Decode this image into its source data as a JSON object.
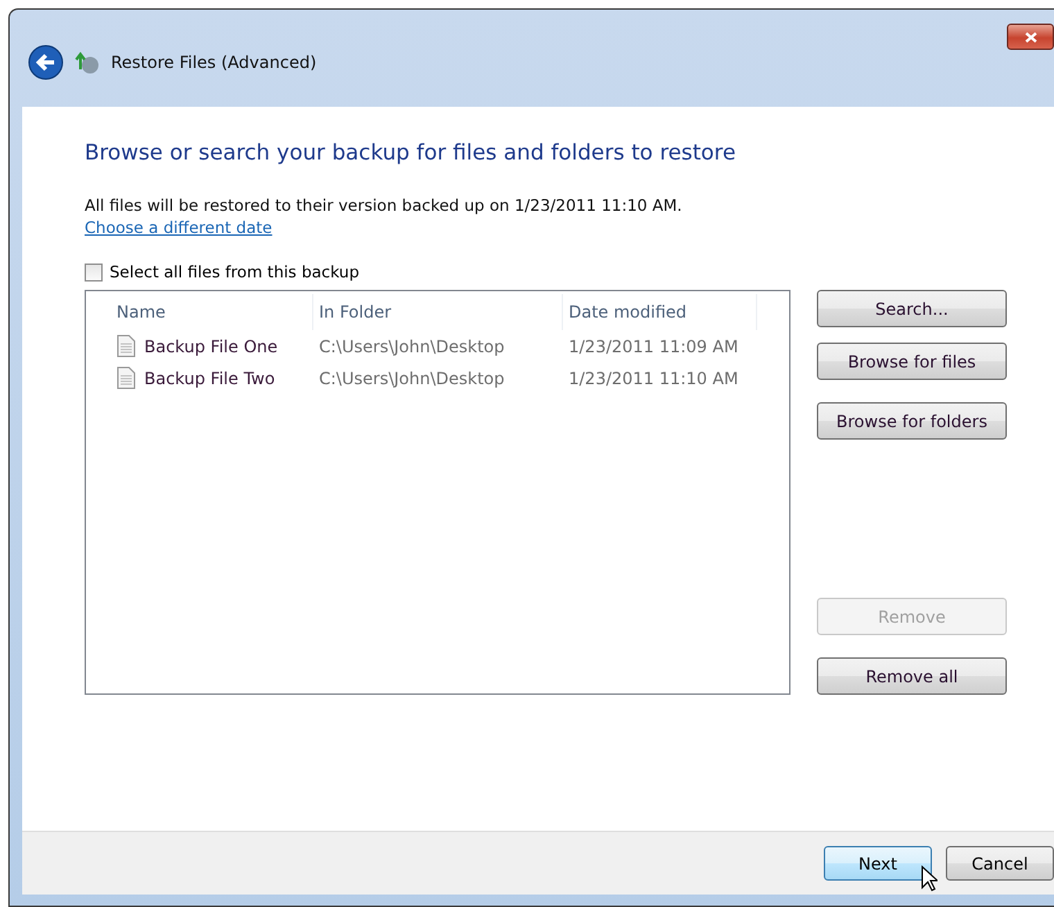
{
  "window": {
    "title": "Restore Files (Advanced)"
  },
  "heading": "Browse or search your backup for files and folders to restore",
  "info": "All files will be restored to their version backed up on 1/23/2011 11:10 AM.",
  "date_link": "Choose a different date",
  "select_all": {
    "label": "Select all files from this backup",
    "checked": false
  },
  "table": {
    "columns": [
      "Name",
      "In Folder",
      "Date modified"
    ],
    "rows": [
      {
        "name": "Backup File One",
        "folder": "C:\\Users\\John\\Desktop",
        "modified": "1/23/2011 11:09 AM"
      },
      {
        "name": "Backup File Two",
        "folder": "C:\\Users\\John\\Desktop",
        "modified": "1/23/2011 11:10 AM"
      }
    ]
  },
  "side_buttons": [
    {
      "label": "Search...",
      "disabled": false
    },
    {
      "label": "Browse for files",
      "disabled": false
    },
    {
      "label": "Browse for folders",
      "disabled": false
    }
  ],
  "side_buttons_lower": [
    {
      "label": "Remove",
      "disabled": true
    },
    {
      "label": "Remove all",
      "disabled": false
    }
  ],
  "footer_buttons": [
    {
      "label": "Next",
      "focused": true
    },
    {
      "label": "Cancel",
      "focused": false
    }
  ]
}
